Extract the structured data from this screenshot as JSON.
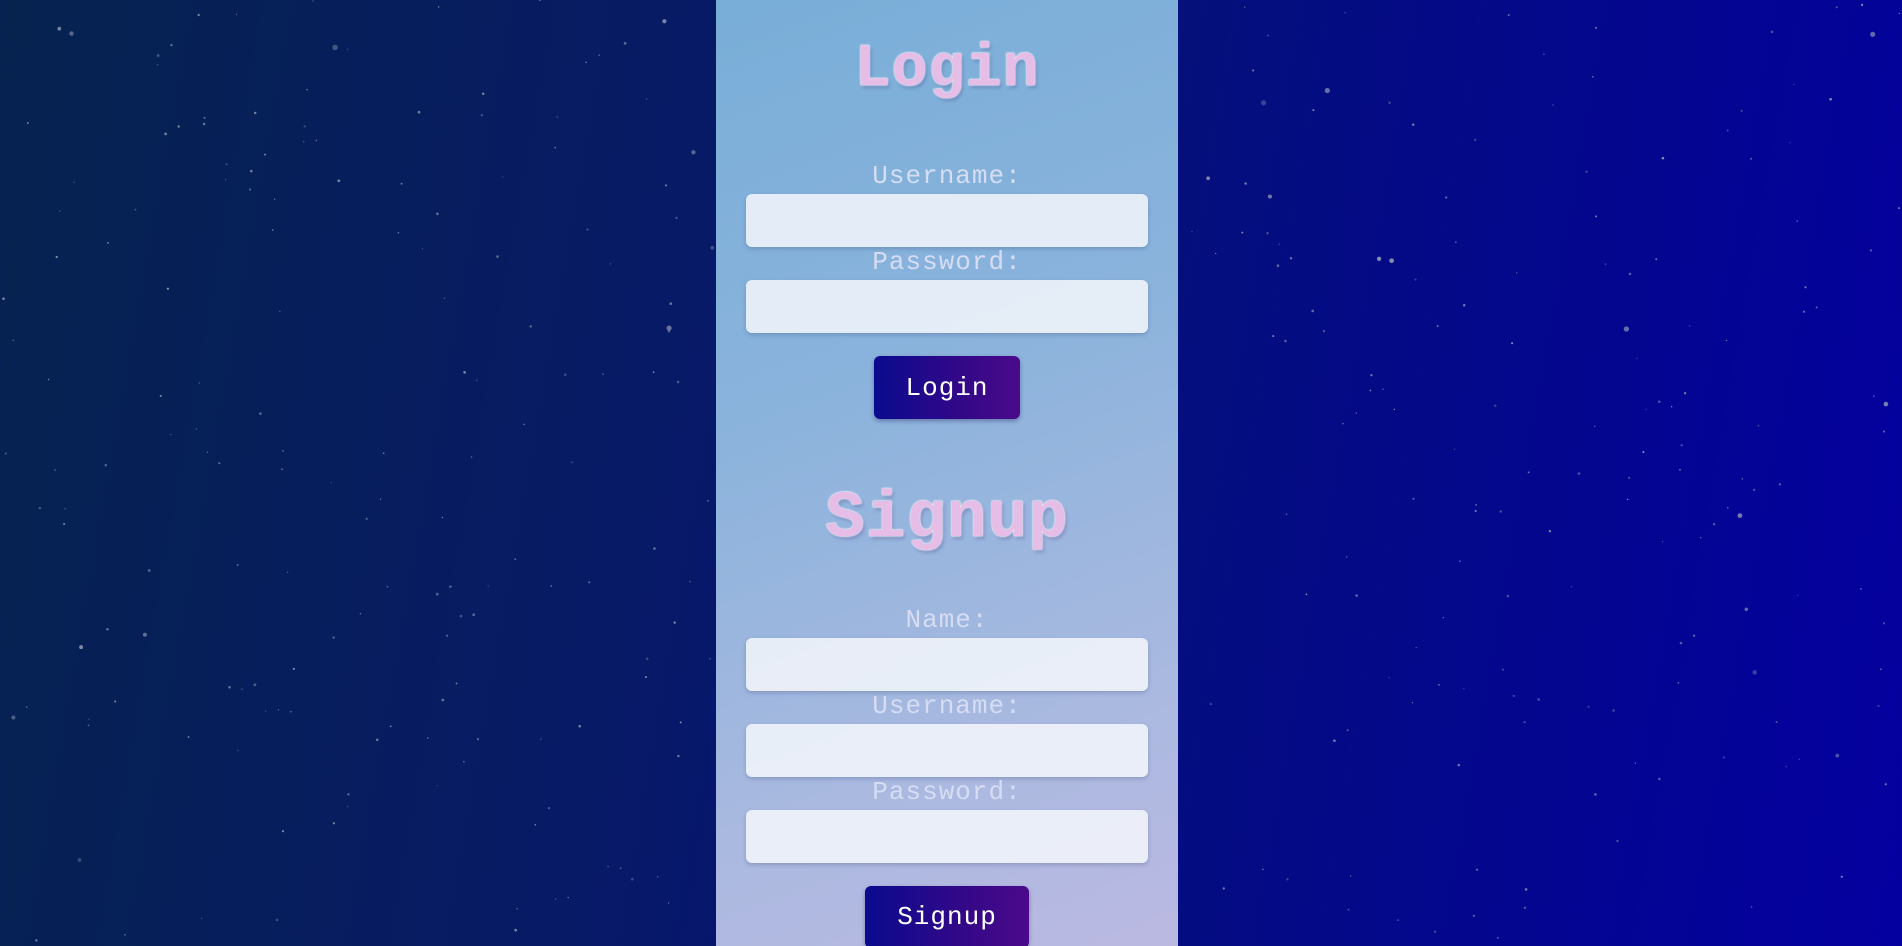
{
  "login": {
    "title": "Login",
    "username_label": "Username:",
    "password_label": "Password:",
    "username_value": "",
    "password_value": "",
    "button_label": "Login"
  },
  "signup": {
    "title": "Signup",
    "name_label": "Name:",
    "username_label": "Username:",
    "password_label": "Password:",
    "name_value": "",
    "username_value": "",
    "password_value": "",
    "button_label": "Signup"
  },
  "colors": {
    "background_dark": "#06234f",
    "background_blue": "#0400a0",
    "panel_top": "#78aed8",
    "panel_bottom": "#bbb9e2",
    "heading": "#e6bde6",
    "button": "#1a0a8c"
  }
}
